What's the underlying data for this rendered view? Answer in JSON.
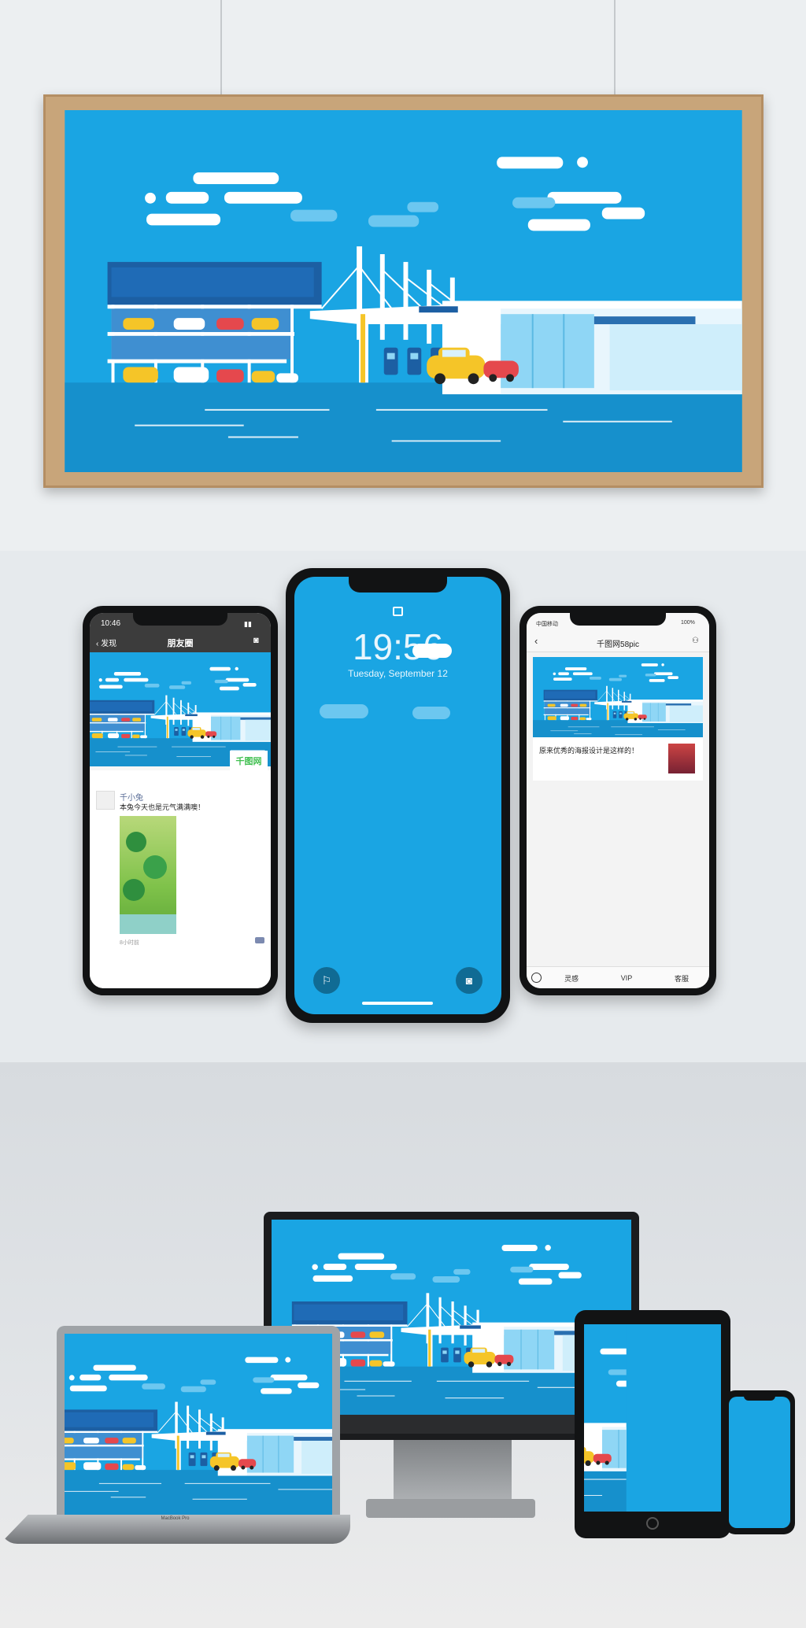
{
  "colors": {
    "sky": "#1aa5e3",
    "ground": "#1690cc",
    "building_dark": "#1c5fa3",
    "taxi_yellow": "#f5c528",
    "car_red": "#e5484d",
    "wechat_bar": "#3c3c3c",
    "brand_green": "#3fbf4f"
  },
  "icons": [
    "lock-icon",
    "flashlight-icon",
    "camera-icon",
    "back-chevron-icon",
    "person-icon",
    "signal-icon",
    "battery-icon"
  ],
  "phone_left": {
    "time": "10:46",
    "back_label": "发现",
    "title": "朋友圈",
    "brand_badge": "千图网",
    "user_name": "千小兔",
    "post_text": "本兔今天也是元气满满噢！",
    "post_time": "8小时前"
  },
  "phone_center": {
    "clock": "19:56",
    "date": "Tuesday, September 12"
  },
  "phone_right": {
    "carrier": "中国移动",
    "battery": "100%",
    "title": "千图网58pic",
    "article_title": "原来优秀的海报设计是这样的！",
    "tabs": [
      "灵感",
      "VIP",
      "客服"
    ]
  },
  "laptop": {
    "brand": "MacBook Pro"
  }
}
